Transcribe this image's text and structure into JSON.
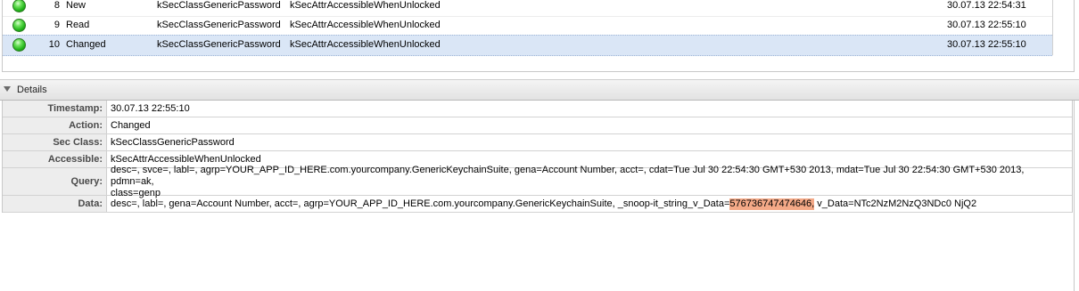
{
  "events": [
    {
      "num": "8",
      "action": "New",
      "sec_class": "kSecClassGenericPassword",
      "accessible": "kSecAttrAccessibleWhenUnlocked",
      "timestamp": "30.07.13 22:54:31"
    },
    {
      "num": "9",
      "action": "Read",
      "sec_class": "kSecClassGenericPassword",
      "accessible": "kSecAttrAccessibleWhenUnlocked",
      "timestamp": "30.07.13 22:55:10"
    },
    {
      "num": "10",
      "action": "Changed",
      "sec_class": "kSecClassGenericPassword",
      "accessible": "kSecAttrAccessibleWhenUnlocked",
      "timestamp": "30.07.13 22:55:10"
    }
  ],
  "status_color": "#22b51a",
  "selected_row_color": "#dae6f6",
  "details": {
    "header": "Details",
    "timestamp_label": "Timestamp:",
    "timestamp": "30.07.13 22:55:10",
    "action_label": "Action:",
    "action": "Changed",
    "sec_class_label": "Sec Class:",
    "sec_class": "kSecClassGenericPassword",
    "accessible_label": "Accessible:",
    "accessible": "kSecAttrAccessibleWhenUnlocked",
    "query_label": "Query:",
    "query_line1": "desc=, svce=, labl=, agrp=YOUR_APP_ID_HERE.com.yourcompany.GenericKeychainSuite, gena=Account Number, acct=, cdat=Tue Jul 30 22:54:30 GMT+530 2013, mdat=Tue Jul 30 22:54:30 GMT+530 2013, pdmn=ak,",
    "query_line2": "class=genp",
    "data_label": "Data:",
    "data_prefix": "desc=, labl=, gena=Account Number, acct=, agrp=YOUR_APP_ID_HERE.com.yourcompany.GenericKeychainSuite, _snoop-it_string_v_Data=",
    "data_highlight": "576736747474646,",
    "data_suffix": " v_Data=NTc2NzM2NzQ3NDc0 NjQ2",
    "highlight_color": "#f4a987"
  }
}
